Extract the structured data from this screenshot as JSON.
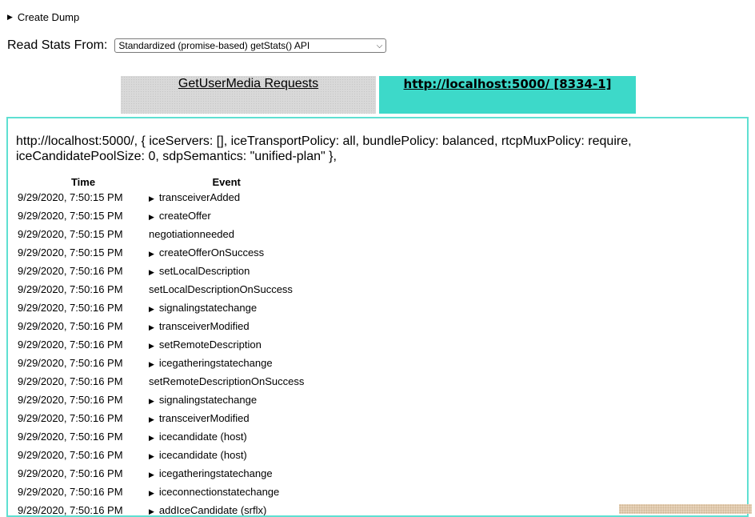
{
  "create_dump": {
    "label": "Create Dump"
  },
  "read_stats": {
    "label": "Read Stats From:",
    "selected": "Standardized (promise-based) getStats() API"
  },
  "tabs": [
    {
      "label": "GetUserMedia Requests",
      "active": false
    },
    {
      "label": "http://localhost:5000/ [8334-1]",
      "active": true
    }
  ],
  "panel": {
    "config": "http://localhost:5000/, { iceServers: [], iceTransportPolicy: all, bundlePolicy: balanced, rtcpMuxPolicy: require, iceCandidatePoolSize: 0, sdpSemantics: \"unified-plan\" },",
    "columns": [
      "Time",
      "Event"
    ],
    "rows": [
      {
        "time": "9/29/2020, 7:50:15 PM",
        "event": "transceiverAdded",
        "expandable": true
      },
      {
        "time": "9/29/2020, 7:50:15 PM",
        "event": "createOffer",
        "expandable": true
      },
      {
        "time": "9/29/2020, 7:50:15 PM",
        "event": "negotiationneeded",
        "expandable": false
      },
      {
        "time": "9/29/2020, 7:50:15 PM",
        "event": "createOfferOnSuccess",
        "expandable": true
      },
      {
        "time": "9/29/2020, 7:50:16 PM",
        "event": "setLocalDescription",
        "expandable": true
      },
      {
        "time": "9/29/2020, 7:50:16 PM",
        "event": "setLocalDescriptionOnSuccess",
        "expandable": false
      },
      {
        "time": "9/29/2020, 7:50:16 PM",
        "event": "signalingstatechange",
        "expandable": true
      },
      {
        "time": "9/29/2020, 7:50:16 PM",
        "event": "transceiverModified",
        "expandable": true
      },
      {
        "time": "9/29/2020, 7:50:16 PM",
        "event": "setRemoteDescription",
        "expandable": true
      },
      {
        "time": "9/29/2020, 7:50:16 PM",
        "event": "icegatheringstatechange",
        "expandable": true
      },
      {
        "time": "9/29/2020, 7:50:16 PM",
        "event": "setRemoteDescriptionOnSuccess",
        "expandable": false
      },
      {
        "time": "9/29/2020, 7:50:16 PM",
        "event": "signalingstatechange",
        "expandable": true
      },
      {
        "time": "9/29/2020, 7:50:16 PM",
        "event": "transceiverModified",
        "expandable": true
      },
      {
        "time": "9/29/2020, 7:50:16 PM",
        "event": "icecandidate (host)",
        "expandable": true
      },
      {
        "time": "9/29/2020, 7:50:16 PM",
        "event": "icecandidate (host)",
        "expandable": true
      },
      {
        "time": "9/29/2020, 7:50:16 PM",
        "event": "icegatheringstatechange",
        "expandable": true
      },
      {
        "time": "9/29/2020, 7:50:16 PM",
        "event": "iceconnectionstatechange",
        "expandable": true
      },
      {
        "time": "9/29/2020, 7:50:16 PM",
        "event": "addIceCandidate (srflx)",
        "expandable": true
      }
    ]
  },
  "icons": {
    "expand": "triangle-right-icon",
    "select": "chevron-down-icon"
  },
  "colors": {
    "active_tab": "#3dd9c9",
    "inactive_tab": "#d9d9d9",
    "panel_border": "#5fe0d2"
  }
}
